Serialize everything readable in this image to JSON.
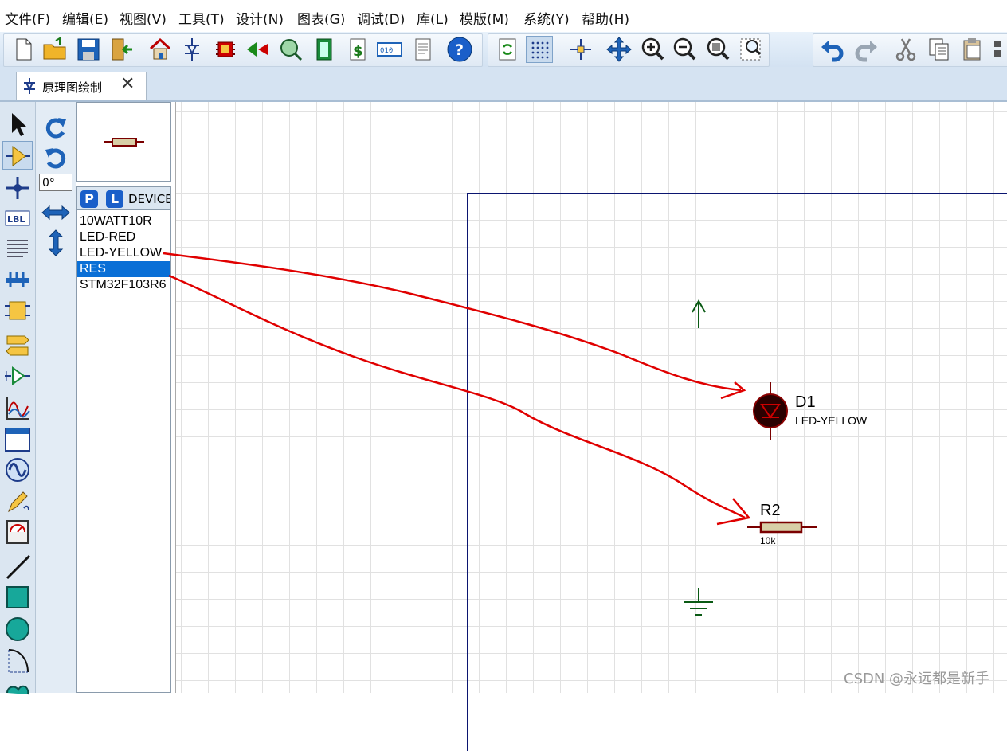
{
  "menu": [
    "文件(F)",
    "编辑(E)",
    "视图(V)",
    "工具(T)",
    "设计(N)",
    "图表(G)",
    "调试(D)",
    "库(L)",
    "模版(M)",
    "系统(Y)",
    "帮助(H)"
  ],
  "tab": {
    "title": "原理图绘制",
    "close": "✕"
  },
  "rotation": {
    "angle": "0°"
  },
  "device_panel": {
    "p_button": "P",
    "l_button": "L",
    "header": "DEVICES",
    "items": [
      "10WATT10R",
      "LED-RED",
      "LED-YELLOW",
      "RES",
      "STM32F103R6"
    ],
    "selected": "RES"
  },
  "schematic": {
    "led": {
      "ref": "D1",
      "value": "LED-YELLOW"
    },
    "resistor": {
      "ref": "R2",
      "value": "10k"
    }
  },
  "watermark": "CSDN @永远都是新手",
  "colors": {
    "wire": "#8b0000",
    "annotation": "#e00000",
    "sheet_border": "#0b1570",
    "terminal": "#0a5a14",
    "selection": "#0a6fd6"
  }
}
